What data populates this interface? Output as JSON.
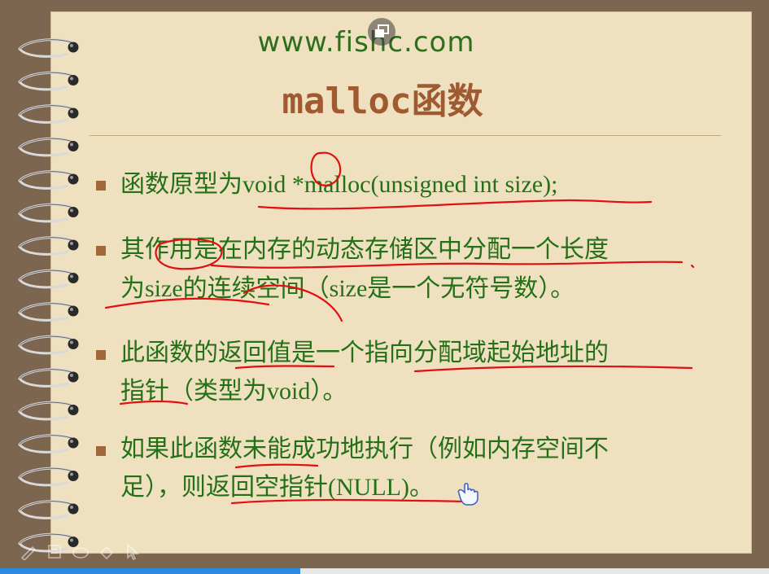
{
  "slide": {
    "site": "www.fishc.com",
    "title": "malloc函数",
    "bullets": [
      {
        "lines": [
          [
            {
              "t": "函数原型为",
              "f": "cn"
            },
            {
              "t": "void *malloc(unsigned int size);",
              "f": "serif"
            }
          ]
        ]
      },
      {
        "lines": [
          [
            {
              "t": "其作用是在内存的动态存储区中分配一个长度",
              "f": "cn"
            }
          ],
          [
            {
              "t": "为",
              "f": "cn"
            },
            {
              "t": "size",
              "f": "serif"
            },
            {
              "t": "的连续空间（",
              "f": "cn"
            },
            {
              "t": "size",
              "f": "serif"
            },
            {
              "t": "是一个无符号数）。",
              "f": "cn"
            }
          ]
        ]
      },
      {
        "lines": [
          [
            {
              "t": "此函数的返回值是一个指向分配域起始地址的",
              "f": "cn"
            }
          ],
          [
            {
              "t": "指针（类型为",
              "f": "cn"
            },
            {
              "t": "void",
              "f": "serif"
            },
            {
              "t": "）。",
              "f": "cn"
            }
          ]
        ]
      },
      {
        "lines": [
          [
            {
              "t": "如果此函数未能成功地执行（例如内存空间不",
              "f": "cn"
            }
          ],
          [
            {
              "t": "足），则返回空指针",
              "f": "cn"
            },
            {
              "t": "(NULL)",
              "f": "serif"
            },
            {
              "t": "。",
              "f": "cn"
            }
          ]
        ]
      }
    ]
  },
  "colors": {
    "text": "#247018",
    "title": "#a05a32",
    "annotation": "#e01010",
    "paper": "#efe1c0",
    "frame": "#7d6650"
  },
  "toolbar": {
    "icons": [
      "pen-icon",
      "notes-icon",
      "eraser-icon",
      "highlighter-icon",
      "pointer-icon"
    ]
  },
  "playback": {
    "progress": 0.39
  }
}
